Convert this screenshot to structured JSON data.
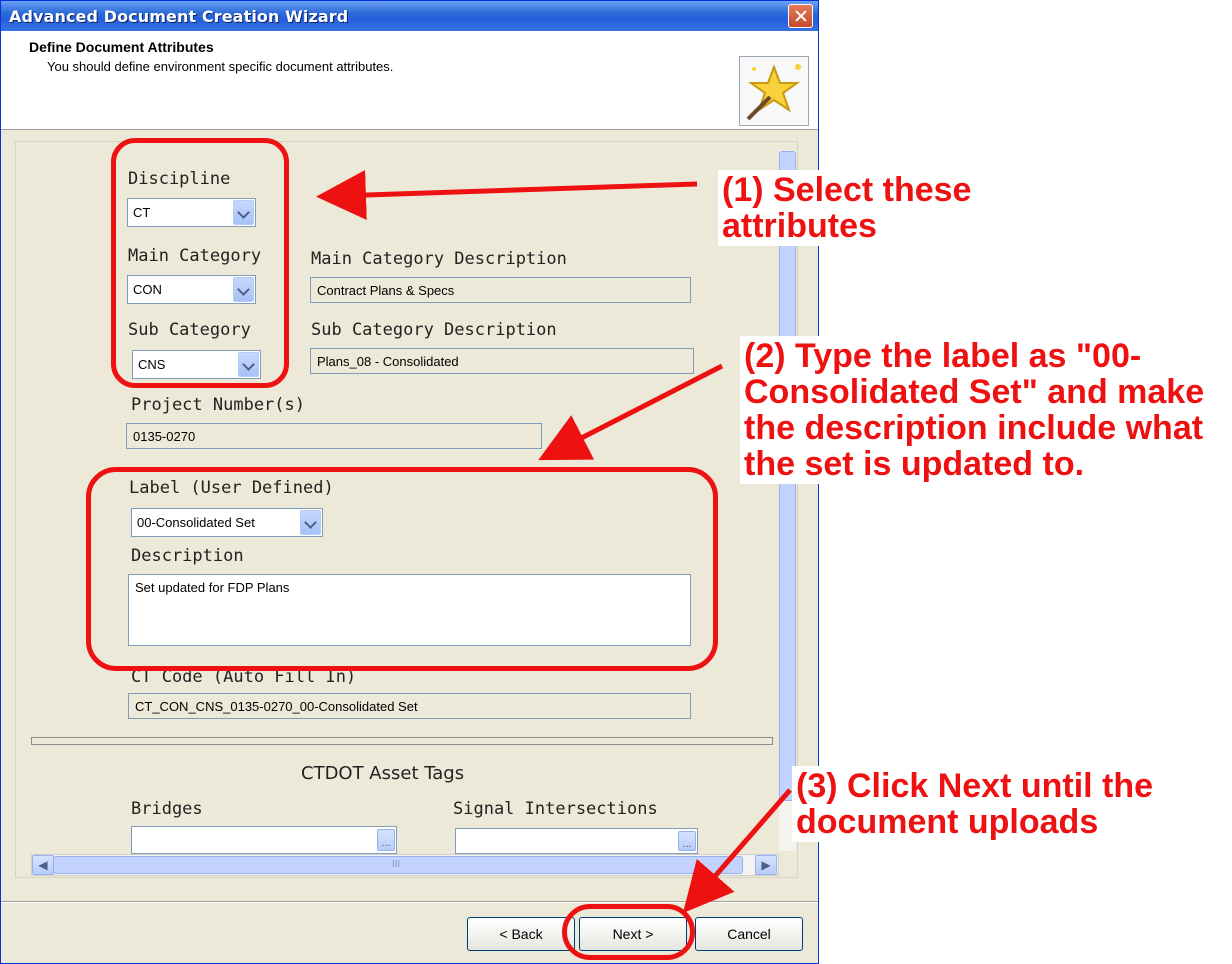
{
  "window": {
    "title": "Advanced Document Creation Wizard",
    "close_icon": "close-icon"
  },
  "header": {
    "title": "Define Document Attributes",
    "subtitle": "You should define environment specific document attributes.",
    "icon": "wizard-wand-icon"
  },
  "form": {
    "discipline": {
      "label": "Discipline",
      "value": "CT"
    },
    "main_category": {
      "label": "Main Category",
      "value": "CON"
    },
    "main_category_desc": {
      "label": "Main Category Description",
      "value": "Contract Plans & Specs"
    },
    "sub_category": {
      "label": "Sub Category",
      "value": "CNS"
    },
    "sub_category_desc": {
      "label": "Sub Category Description",
      "value": "Plans_08 - Consolidated"
    },
    "project_numbers": {
      "label": "Project Number(s)",
      "value": "0135-0270"
    },
    "label": {
      "label": "Label (User Defined)",
      "value": "00-Consolidated Set"
    },
    "description": {
      "label": "Description",
      "value": "Set updated for FDP Plans"
    },
    "ct_code": {
      "label": "CT Code (Auto Fill In)",
      "value": "CT_CON_CNS_0135-0270_00-Consolidated Set"
    }
  },
  "asset_tags": {
    "title": "CTDOT Asset Tags",
    "bridges": {
      "label": "Bridges",
      "browse": "..."
    },
    "signals": {
      "label": "Signal Intersections",
      "browse": "..."
    }
  },
  "scrollbar": {
    "grip": "III"
  },
  "buttons": {
    "back": "< Back",
    "next": "Next >",
    "cancel": "Cancel"
  },
  "annotations": {
    "step1": "(1) Select these attributes",
    "step2": "(2) Type the label as \"00-Consolidated Set\" and make the description include what the set is updated to.",
    "step3": "(3) Click Next until the document uploads",
    "color": "#ee1111"
  }
}
